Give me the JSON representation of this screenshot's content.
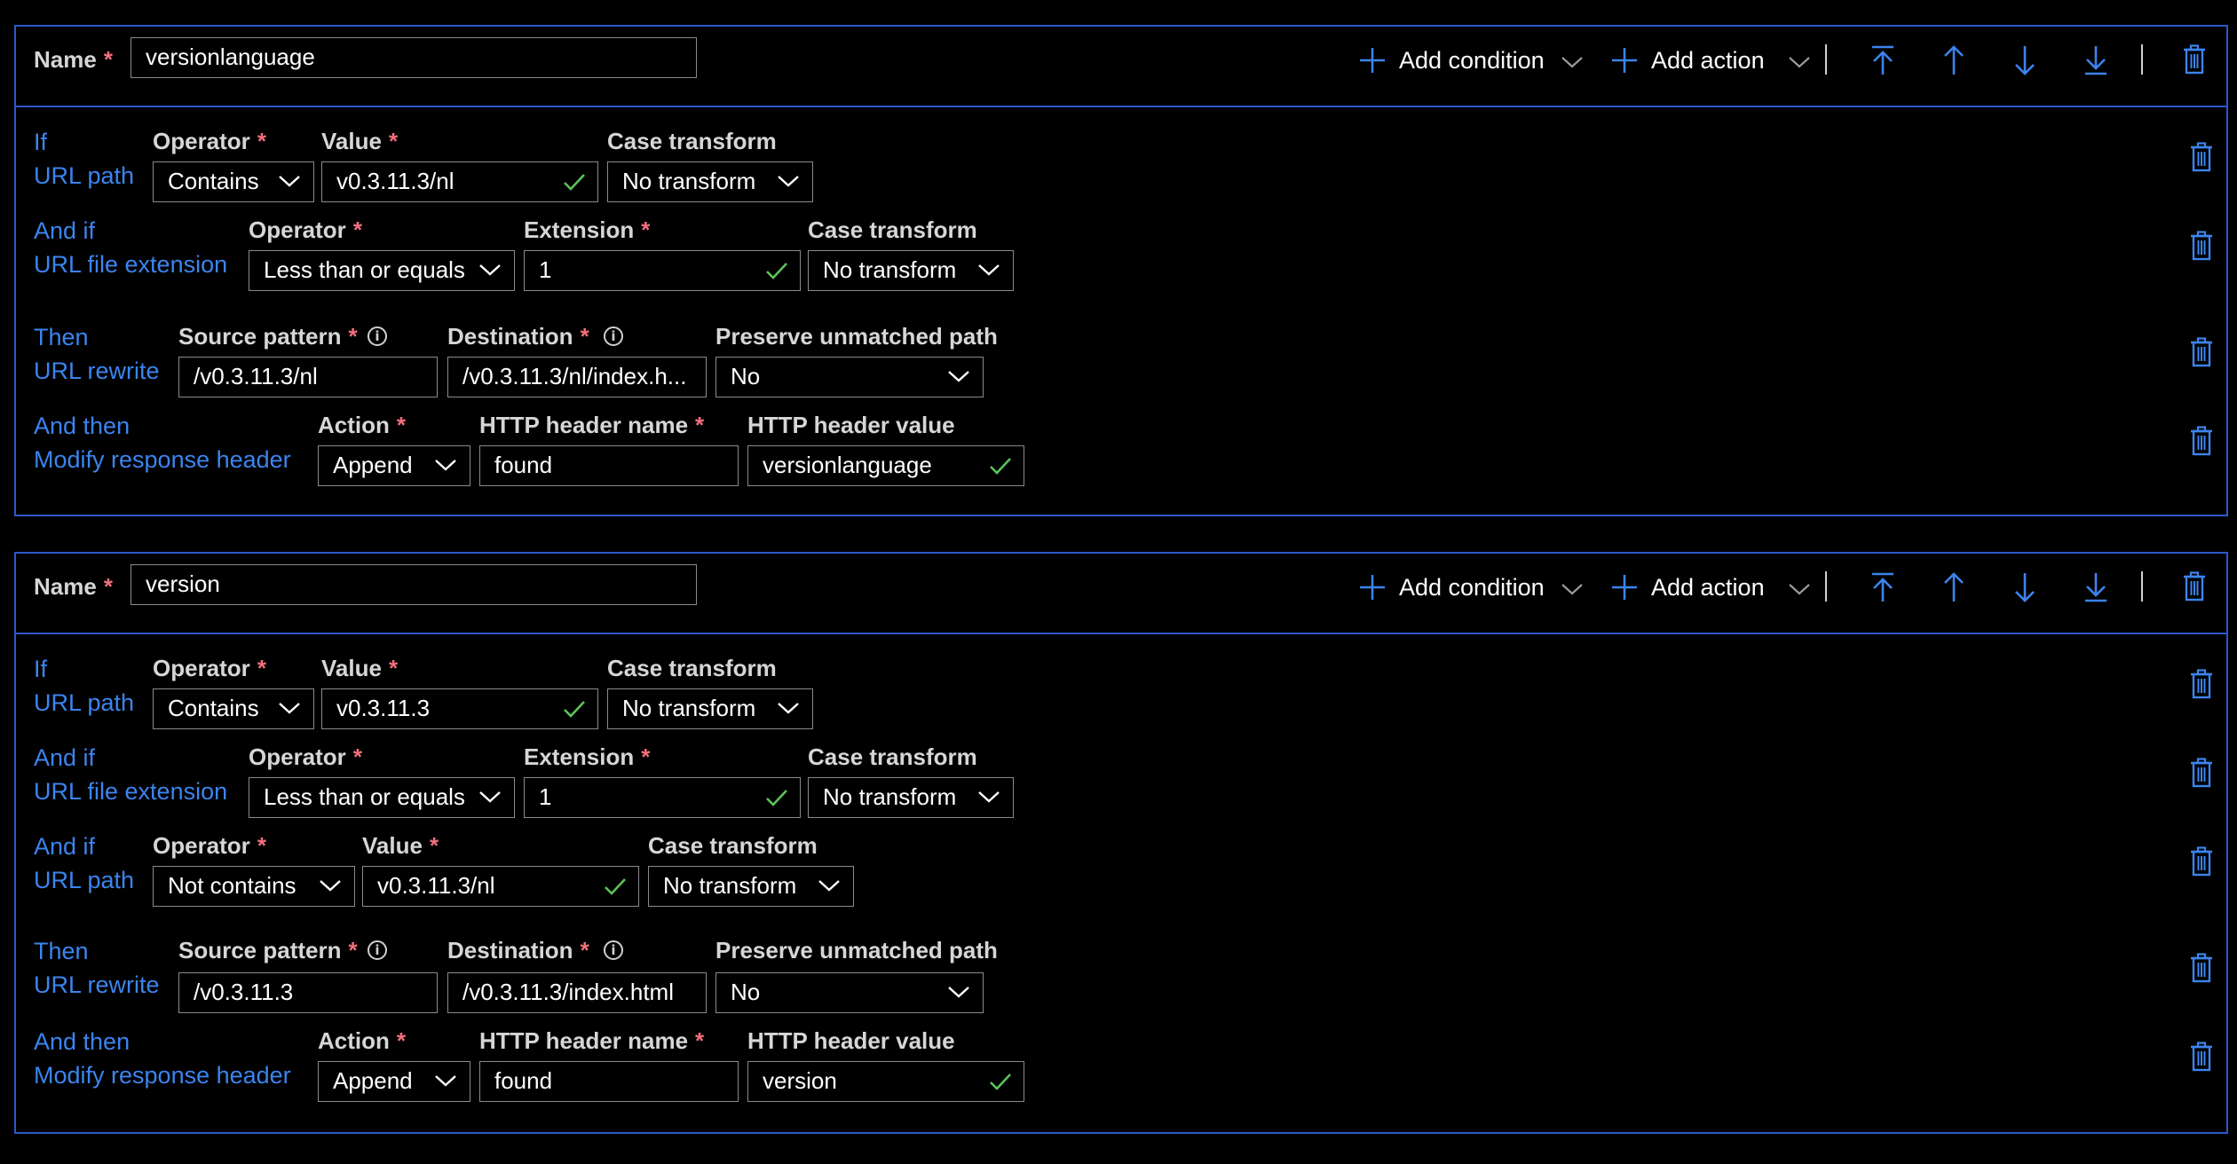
{
  "toolbar": {
    "add_condition": "Add condition",
    "add_action": "Add action",
    "icons": [
      "plus-icon",
      "chevron-down-icon",
      "move-to-top-icon",
      "move-up-icon",
      "move-down-icon",
      "move-to-bottom-icon",
      "trash-icon",
      "info-icon",
      "checkmark-icon"
    ]
  },
  "colors": {
    "accent": "#3c84ee",
    "border": "#2e57c9",
    "required": "#f1707b",
    "check": "#5cc25a"
  },
  "rules": [
    {
      "name_label": "Name",
      "name_value": "versionlanguage",
      "cond1": {
        "kw": "If",
        "type": "URL path",
        "op_label": "Operator",
        "op_value": "Contains",
        "val_label": "Value",
        "val_value": "v0.3.11.3/nl",
        "ct_label": "Case transform",
        "ct_value": "No transform"
      },
      "cond2": {
        "kw": "And if",
        "type": "URL file extension",
        "op_label": "Operator",
        "op_value": "Less than or equals",
        "val_label": "Extension",
        "val_value": "1",
        "ct_label": "Case transform",
        "ct_value": "No transform"
      },
      "act1": {
        "kw": "Then",
        "type": "URL rewrite",
        "src_label": "Source pattern",
        "src_value": "/v0.3.11.3/nl",
        "dst_label": "Destination",
        "dst_value": "/v0.3.11.3/nl/index.h...",
        "pres_label": "Preserve unmatched path",
        "pres_value": "No"
      },
      "act2": {
        "kw": "And then",
        "type": "Modify response header",
        "action_label": "Action",
        "action_value": "Append",
        "hname_label": "HTTP header name",
        "hname_value": "found",
        "hval_label": "HTTP header value",
        "hval_value": "versionlanguage"
      }
    },
    {
      "name_label": "Name",
      "name_value": "version",
      "cond1": {
        "kw": "If",
        "type": "URL path",
        "op_label": "Operator",
        "op_value": "Contains",
        "val_label": "Value",
        "val_value": "v0.3.11.3",
        "ct_label": "Case transform",
        "ct_value": "No transform"
      },
      "cond2": {
        "kw": "And if",
        "type": "URL file extension",
        "op_label": "Operator",
        "op_value": "Less than or equals",
        "val_label": "Extension",
        "val_value": "1",
        "ct_label": "Case transform",
        "ct_value": "No transform"
      },
      "cond3": {
        "kw": "And if",
        "type": "URL path",
        "op_label": "Operator",
        "op_value": "Not contains",
        "val_label": "Value",
        "val_value": "v0.3.11.3/nl",
        "ct_label": "Case transform",
        "ct_value": "No transform"
      },
      "act1": {
        "kw": "Then",
        "type": "URL rewrite",
        "src_label": "Source pattern",
        "src_value": "/v0.3.11.3",
        "dst_label": "Destination",
        "dst_value": "/v0.3.11.3/index.html",
        "pres_label": "Preserve unmatched path",
        "pres_value": "No"
      },
      "act2": {
        "kw": "And then",
        "type": "Modify response header",
        "action_label": "Action",
        "action_value": "Append",
        "hname_label": "HTTP header name",
        "hname_value": "found",
        "hval_label": "HTTP header value",
        "hval_value": "version"
      }
    }
  ]
}
